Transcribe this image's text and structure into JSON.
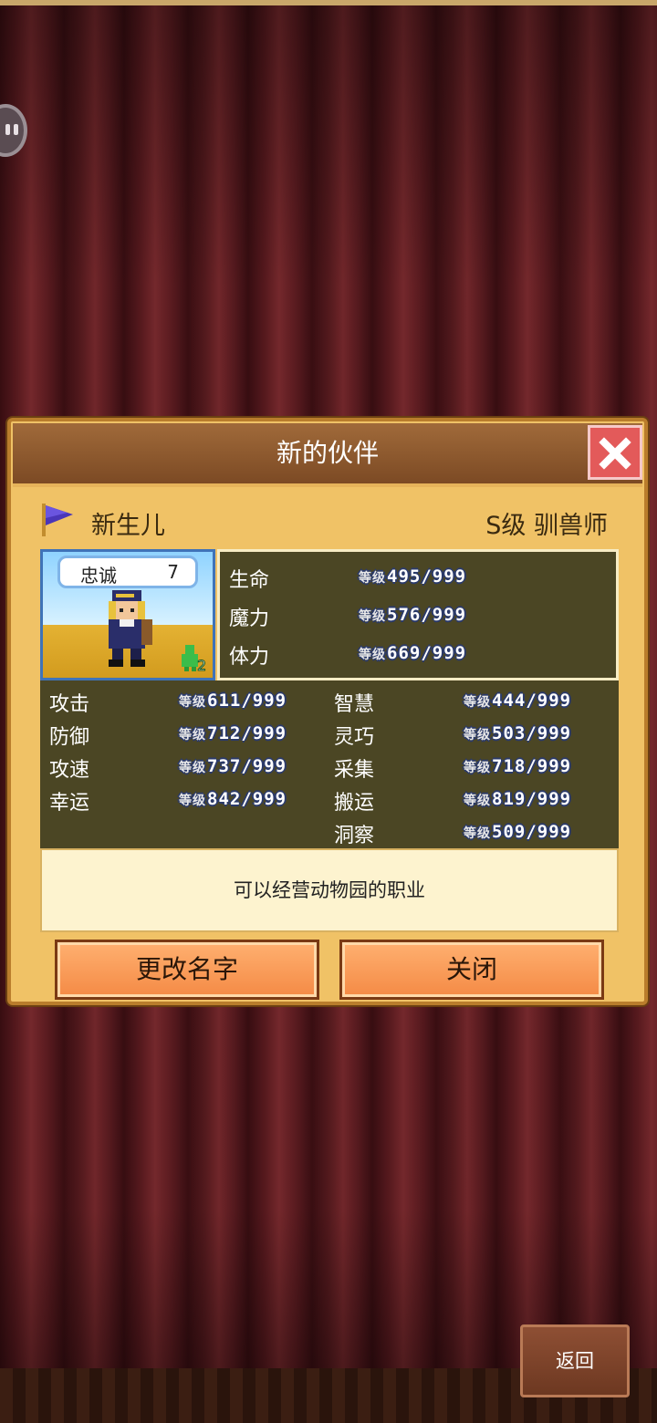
{
  "dialog": {
    "title": "新的伙伴",
    "close_icon": "close-x-icon"
  },
  "character": {
    "name": "新生儿",
    "rank": "S级 驯兽师",
    "loyalty_label": "忠诚",
    "loyalty_value": "7",
    "badge_level": "2",
    "description": "可以经营动物园的职业"
  },
  "vitals": [
    {
      "label": "生命",
      "prefix": "等级",
      "value": "495/999"
    },
    {
      "label": "魔力",
      "prefix": "等级",
      "value": "576/999"
    },
    {
      "label": "体力",
      "prefix": "等级",
      "value": "669/999"
    }
  ],
  "attributes_left": [
    {
      "label": "攻击",
      "prefix": "等级",
      "value": "611/999"
    },
    {
      "label": "防御",
      "prefix": "等级",
      "value": "712/999"
    },
    {
      "label": "攻速",
      "prefix": "等级",
      "value": "737/999"
    },
    {
      "label": "幸运",
      "prefix": "等级",
      "value": "842/999"
    }
  ],
  "attributes_right": [
    {
      "label": "智慧",
      "prefix": "等级",
      "value": "444/999"
    },
    {
      "label": "灵巧",
      "prefix": "等级",
      "value": "503/999"
    },
    {
      "label": "采集",
      "prefix": "等级",
      "value": "718/999"
    },
    {
      "label": "搬运",
      "prefix": "等级",
      "value": "819/999"
    },
    {
      "label": "洞察",
      "prefix": "等级",
      "value": "509/999"
    }
  ],
  "buttons": {
    "rename": "更改名字",
    "close": "关闭",
    "back": "返回"
  },
  "colors": {
    "dialog_bg": "#f0c266",
    "header_bg": "#7c4a24",
    "stat_panel": "#4b4624",
    "button": "#f48a45",
    "close_button": "#e35a5a"
  }
}
